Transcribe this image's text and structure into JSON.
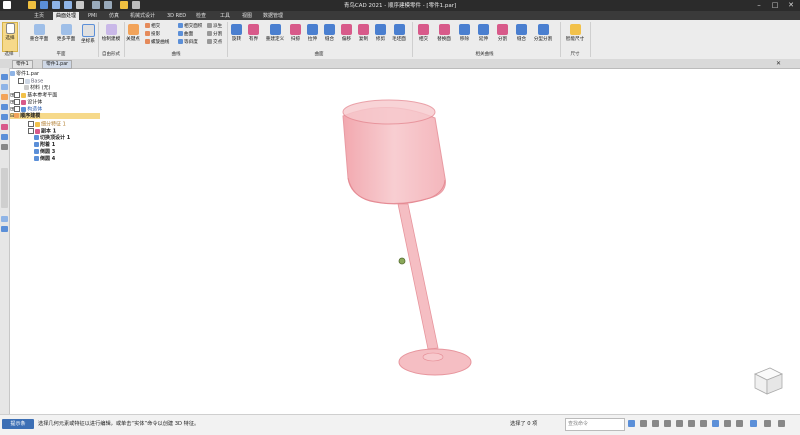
{
  "window": {
    "title": "青鸟CAD 2021 - 顺序建模零件 - [零件1.par]",
    "controls": [
      "–",
      "□",
      "✕"
    ]
  },
  "menu_tabs": [
    "主页",
    "曲面处理",
    "PMI",
    "仿真",
    "机械式设计",
    "3D RED",
    "检查",
    "工具",
    "视图",
    "数据管理"
  ],
  "active_menu_tab": "曲面处理",
  "ribbon": {
    "select_label": "选择",
    "select_group": "选择",
    "plane_buttons": [
      "重合平面",
      "更多平面",
      "坐标系"
    ],
    "plane_group": "平面",
    "freeform_button": "绘制建模",
    "freeform_group": "自由形式",
    "curve_button": "关键点",
    "curve_small": [
      "相交",
      "投影",
      "螺旋曲线",
      "相交面积",
      "曲面",
      "等斜度",
      "派生",
      "分割",
      "交点"
    ],
    "curve_group": "曲线",
    "surface_buttons": [
      "旋转",
      "有界",
      "重建定义",
      "扫掠",
      "拉伸",
      "缝合",
      "偏移",
      "复制",
      "修剪",
      "毛坯面"
    ],
    "surface_group": "曲面",
    "modify_buttons": [
      "相交",
      "替换面",
      "移除",
      "延伸",
      "分割",
      "缝合",
      "分型分割"
    ],
    "modify_group": "相关曲线",
    "size_button": "智能尺寸",
    "size_group": "尺寸"
  },
  "doc_tabs": [
    "零件1",
    "零件1.par"
  ],
  "active_doc_tab": "零件1.par",
  "tree": {
    "root": "零件1.par",
    "items": [
      {
        "label": "Base",
        "indent": 1,
        "check": false
      },
      {
        "label": "材料 (无)",
        "indent": 1,
        "check": false
      },
      {
        "label": "基本参考平面",
        "indent": 1,
        "check": true
      },
      {
        "label": "设计体",
        "indent": 1,
        "check": true
      },
      {
        "label": "构造体",
        "indent": 1,
        "check": true
      },
      {
        "label": "顺序建模",
        "indent": 0,
        "check": false
      },
      {
        "label": "细分特征 1",
        "indent": 2,
        "check": false
      },
      {
        "label": "副本 1",
        "indent": 2,
        "check": true
      },
      {
        "label": "切换顶设计 1",
        "indent": 2,
        "check": false
      },
      {
        "label": "附着 1",
        "indent": 2,
        "check": false
      },
      {
        "label": "倒圆 3",
        "indent": 2,
        "check": false
      },
      {
        "label": "倒圆 4",
        "indent": 2,
        "check": false
      }
    ]
  },
  "status": {
    "command_button": "提示条",
    "prompt": "选择几何元素或特征以进行编辑，或单击“实体”命令以创建 3D 特征。",
    "selection": "选择了 0 项",
    "find_placeholder": "查找命令"
  },
  "colors": {
    "accent": "#3c6fb5",
    "model_fill": "#f4b8bd",
    "model_stroke": "#e58a93",
    "ribbon_bg": "#ececec"
  }
}
